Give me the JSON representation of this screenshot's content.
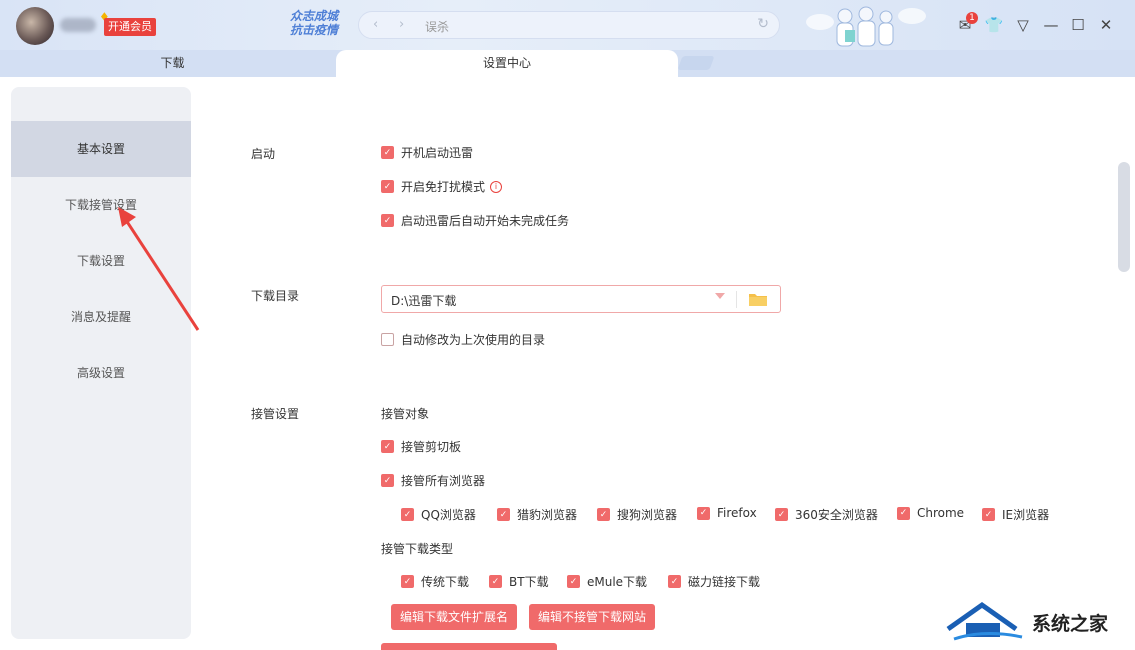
{
  "header": {
    "vip_label": "开通会员",
    "slogan_line1": "众志成城",
    "slogan_line2": "抗击疫情",
    "address_text": "误杀",
    "mail_badge": "1"
  },
  "tabs": [
    {
      "label": "下载"
    },
    {
      "label": "设置中心"
    }
  ],
  "sidebar": {
    "items": [
      {
        "label": "基本设置"
      },
      {
        "label": "下载接管设置"
      },
      {
        "label": "下载设置"
      },
      {
        "label": "消息及提醒"
      },
      {
        "label": "高级设置"
      }
    ]
  },
  "startup": {
    "label": "启动",
    "options": [
      {
        "label": "开机启动迅雷",
        "checked": true
      },
      {
        "label": "开启免打扰模式",
        "checked": true
      },
      {
        "label": "启动迅雷后自动开始未完成任务",
        "checked": true
      }
    ]
  },
  "download_dir": {
    "label": "下载目录",
    "value": "D:\\迅雷下载",
    "auto_modify": {
      "label": "自动修改为上次使用的目录",
      "checked": false
    }
  },
  "takeover": {
    "label": "接管设置",
    "target_title": "接管对象",
    "clipboard": {
      "label": "接管剪切板",
      "checked": true
    },
    "all_browsers": {
      "label": "接管所有浏览器",
      "checked": true
    },
    "browsers": [
      {
        "label": "QQ浏览器",
        "checked": true
      },
      {
        "label": "猎豹浏览器",
        "checked": true
      },
      {
        "label": "搜狗浏览器",
        "checked": true
      },
      {
        "label": "Firefox",
        "checked": true
      },
      {
        "label": "360安全浏览器",
        "checked": true
      },
      {
        "label": "Chrome",
        "checked": true
      },
      {
        "label": "IE浏览器",
        "checked": true
      }
    ],
    "types_title": "接管下载类型",
    "types": [
      {
        "label": "传统下载",
        "checked": true
      },
      {
        "label": "BT下载",
        "checked": true
      },
      {
        "label": "eMule下载",
        "checked": true
      },
      {
        "label": "磁力链接下载",
        "checked": true
      }
    ],
    "edit_ext_button": "编辑下载文件扩展名",
    "edit_site_button": "编辑不接管下载网站"
  },
  "watermark": {
    "text": "系统之家"
  },
  "colors": {
    "accent": "#f06a6a",
    "vip": "#e9423d",
    "titlebar": "#dbe5f6"
  }
}
